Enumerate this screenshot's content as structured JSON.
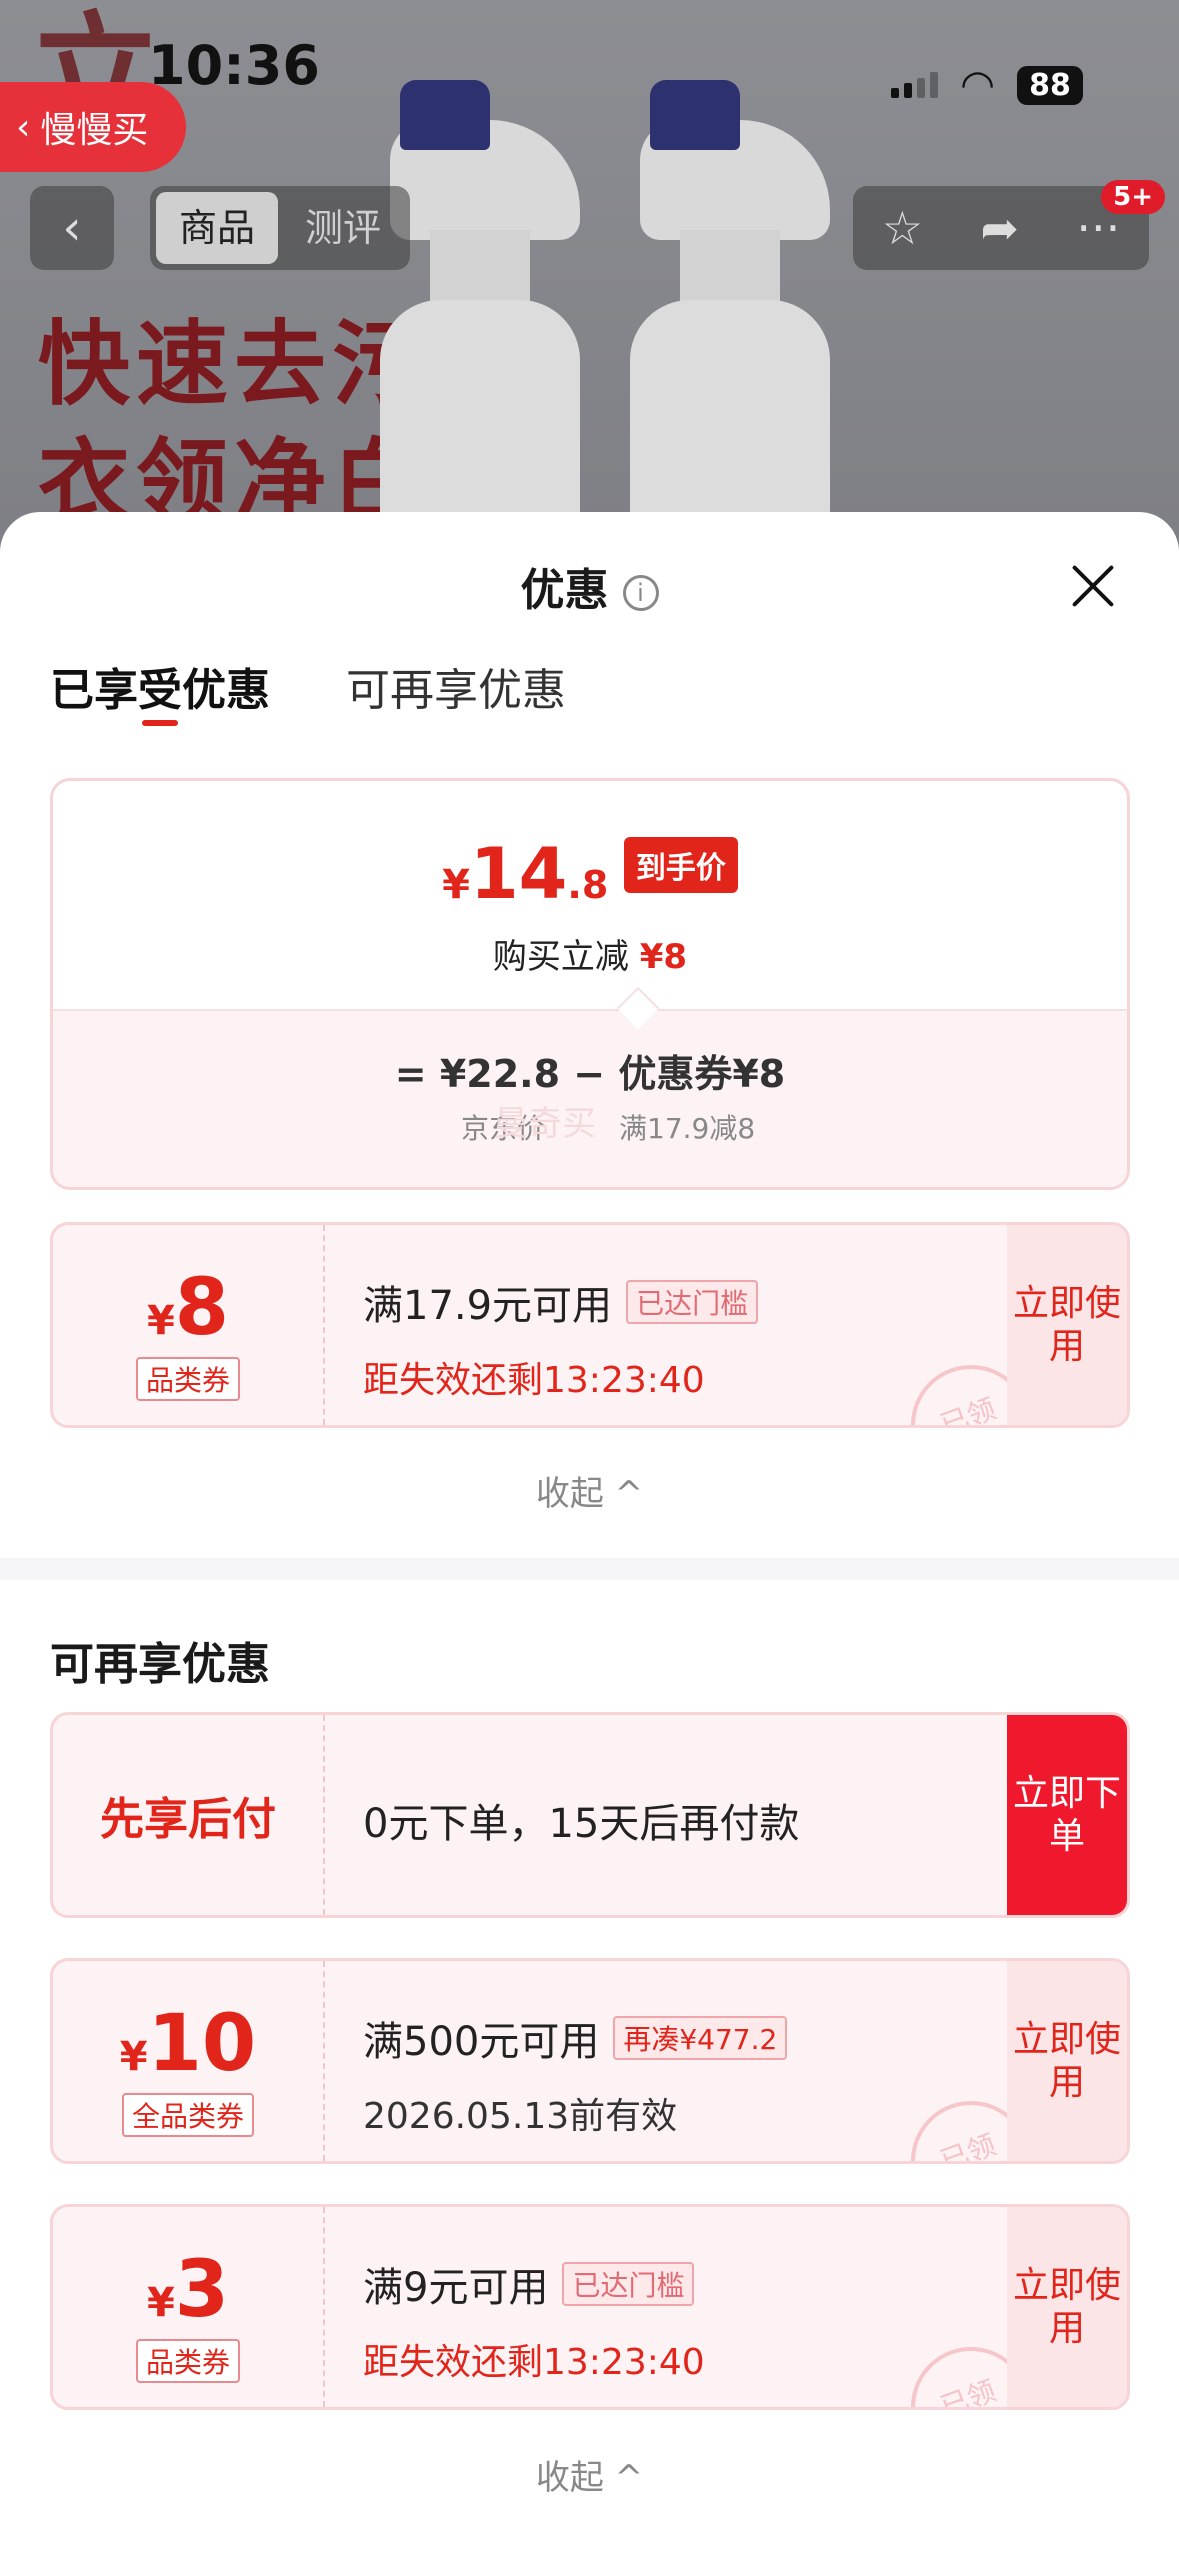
{
  "status_bar": {
    "time": "10:36",
    "battery": "88"
  },
  "back_app": {
    "label": "慢慢买",
    "small_label": "◀ 慢慢买"
  },
  "product_nav": {
    "tabs": [
      "商品",
      "测评"
    ],
    "badge": "5+",
    "promo_text": [
      "快速去污",
      "衣领净白"
    ]
  },
  "sheet": {
    "title": "优惠",
    "tabs": [
      "已享受优惠",
      "可再享优惠"
    ],
    "summary": {
      "price_yen": "¥",
      "price_int": "14",
      "price_dec": ".8",
      "price_tag": "到手价",
      "reduce_label": "购买立减",
      "reduce_value": "¥8",
      "formula": "=  ¥22.8  −  优惠券¥8",
      "jd_label": "京东价",
      "coupon_rule": "满17.9减8"
    },
    "enjoyed_coupon": {
      "yen": "¥",
      "amount": "8",
      "category": "品类券",
      "condition": "满17.9元可用",
      "tip": "已达门槛",
      "expire": "距失效还剩13:23:40",
      "action": "立即使用",
      "stamp": "已领"
    },
    "collapse_label": "收起 ^",
    "more_section_title": "可再享优惠",
    "pay_later": {
      "label": "先享后付",
      "desc": "0元下单，15天后再付款",
      "action": "立即下单"
    },
    "more_coupons": [
      {
        "yen": "¥",
        "amount": "10",
        "category": "全品类券",
        "condition": "满500元可用",
        "tip": "再凑¥477.2",
        "expire": "2026.05.13前有效",
        "action": "立即使用",
        "stamp": "已领"
      },
      {
        "yen": "¥",
        "amount": "3",
        "category": "品类券",
        "condition": "满9元可用",
        "tip": "已达门槛",
        "expire": "距失效还剩13:23:40",
        "action": "立即使用",
        "stamp": "已领"
      }
    ],
    "watermark": "曼奇买"
  },
  "colors": {
    "accent": "#e1251b",
    "pay_button": "#f0182c",
    "card_bg": "#fdf3f4"
  }
}
